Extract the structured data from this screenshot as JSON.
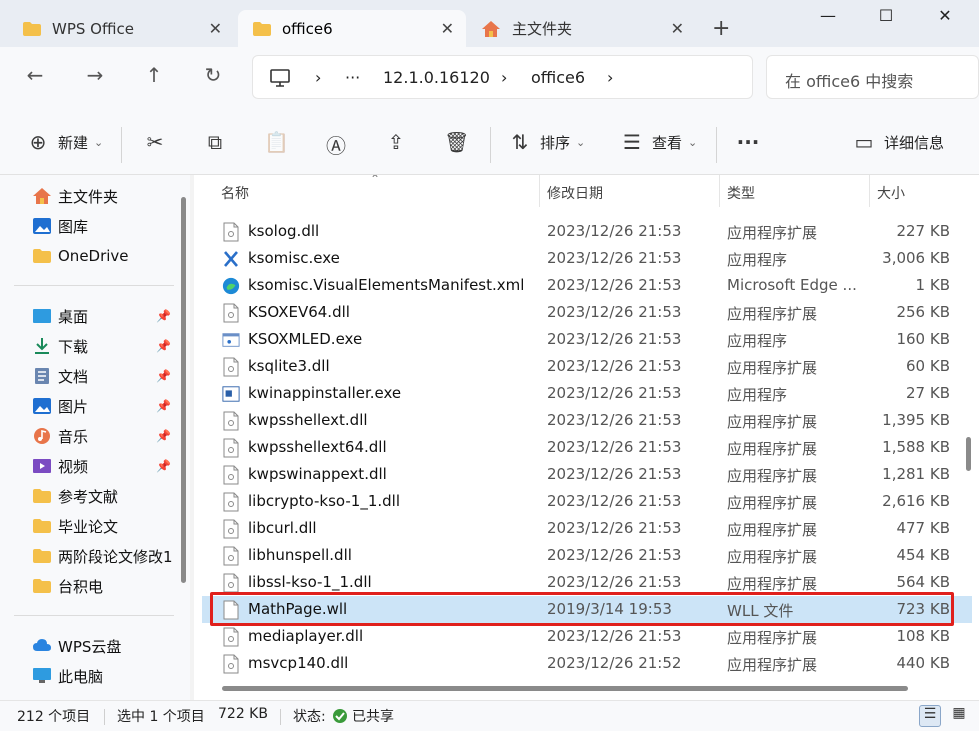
{
  "tabs": [
    {
      "label": "WPS Office",
      "icon": "folder-icon",
      "active": false
    },
    {
      "label": "office6",
      "icon": "folder-icon",
      "active": true
    },
    {
      "label": "主文件夹",
      "icon": "home-icon",
      "active": false
    }
  ],
  "address": {
    "crumbs": [
      "12.1.0.16120",
      "office6"
    ],
    "overflow": "···",
    "chevron": "›"
  },
  "search": {
    "placeholder": "在 office6 中搜索"
  },
  "toolbar": {
    "new_label": "新建",
    "sort_label": "排序",
    "view_label": "查看",
    "more_label": "···",
    "details_label": "详细信息"
  },
  "sidebar": {
    "quick": [
      {
        "label": "主文件夹",
        "icon": "home-icon"
      },
      {
        "label": "图库",
        "icon": "gallery-icon"
      },
      {
        "label": "OneDrive",
        "icon": "folder-icon"
      }
    ],
    "pinned": [
      {
        "label": "桌面",
        "icon": "desktop-icon",
        "pinned": true
      },
      {
        "label": "下载",
        "icon": "download-icon",
        "pinned": true
      },
      {
        "label": "文档",
        "icon": "document-icon",
        "pinned": true
      },
      {
        "label": "图片",
        "icon": "pictures-icon",
        "pinned": true
      },
      {
        "label": "音乐",
        "icon": "music-icon",
        "pinned": true
      },
      {
        "label": "视频",
        "icon": "video-icon",
        "pinned": true
      },
      {
        "label": "参考文献",
        "icon": "folder-icon",
        "pinned": false
      },
      {
        "label": "毕业论文",
        "icon": "folder-icon",
        "pinned": false
      },
      {
        "label": "两阶段论文修改1",
        "icon": "folder-icon",
        "pinned": false
      },
      {
        "label": "台积电",
        "icon": "folder-icon",
        "pinned": false
      }
    ],
    "drives": [
      {
        "label": "WPS云盘",
        "icon": "cloud-icon"
      },
      {
        "label": "此电脑",
        "icon": "computer-icon"
      }
    ]
  },
  "columns": {
    "name": "名称",
    "date": "修改日期",
    "type": "类型",
    "size": "大小"
  },
  "files": [
    {
      "name": "ksolog.dll",
      "date": "2023/12/26 21:53",
      "type": "应用程序扩展",
      "size": "227 KB",
      "icon": "dll-file-icon"
    },
    {
      "name": "ksomisc.exe",
      "date": "2023/12/26 21:53",
      "type": "应用程序",
      "size": "3,006 KB",
      "icon": "tools-icon"
    },
    {
      "name": "ksomisc.VisualElementsManifest.xml",
      "date": "2023/12/26 21:53",
      "type": "Microsoft Edge ...",
      "size": "1 KB",
      "icon": "edge-icon"
    },
    {
      "name": "KSOXEV64.dll",
      "date": "2023/12/26 21:53",
      "type": "应用程序扩展",
      "size": "256 KB",
      "icon": "dll-file-icon"
    },
    {
      "name": "KSOXMLED.exe",
      "date": "2023/12/26 21:53",
      "type": "应用程序",
      "size": "160 KB",
      "icon": "exe-window-icon"
    },
    {
      "name": "ksqlite3.dll",
      "date": "2023/12/26 21:53",
      "type": "应用程序扩展",
      "size": "60 KB",
      "icon": "dll-file-icon"
    },
    {
      "name": "kwinappinstaller.exe",
      "date": "2023/12/26 21:53",
      "type": "应用程序",
      "size": "27 KB",
      "icon": "exe-installer-icon"
    },
    {
      "name": "kwpsshellext.dll",
      "date": "2023/12/26 21:53",
      "type": "应用程序扩展",
      "size": "1,395 KB",
      "icon": "dll-file-icon"
    },
    {
      "name": "kwpsshellext64.dll",
      "date": "2023/12/26 21:53",
      "type": "应用程序扩展",
      "size": "1,588 KB",
      "icon": "dll-file-icon"
    },
    {
      "name": "kwpswinappext.dll",
      "date": "2023/12/26 21:53",
      "type": "应用程序扩展",
      "size": "1,281 KB",
      "icon": "dll-file-icon"
    },
    {
      "name": "libcrypto-kso-1_1.dll",
      "date": "2023/12/26 21:53",
      "type": "应用程序扩展",
      "size": "2,616 KB",
      "icon": "dll-file-icon"
    },
    {
      "name": "libcurl.dll",
      "date": "2023/12/26 21:53",
      "type": "应用程序扩展",
      "size": "477 KB",
      "icon": "dll-file-icon"
    },
    {
      "name": "libhunspell.dll",
      "date": "2023/12/26 21:53",
      "type": "应用程序扩展",
      "size": "454 KB",
      "icon": "dll-file-icon"
    },
    {
      "name": "libssl-kso-1_1.dll",
      "date": "2023/12/26 21:53",
      "type": "应用程序扩展",
      "size": "564 KB",
      "icon": "dll-file-icon"
    },
    {
      "name": "MathPage.wll",
      "date": "2019/3/14 19:53",
      "type": "WLL 文件",
      "size": "723 KB",
      "icon": "blank-file-icon",
      "selected": true
    },
    {
      "name": "mediaplayer.dll",
      "date": "2023/12/26 21:53",
      "type": "应用程序扩展",
      "size": "108 KB",
      "icon": "dll-file-icon"
    },
    {
      "name": "msvcp140.dll",
      "date": "2023/12/26 21:52",
      "type": "应用程序扩展",
      "size": "440 KB",
      "icon": "dll-file-icon"
    }
  ],
  "status": {
    "count": "212 个项目",
    "selection": "选中 1 个项目",
    "selection_size": "722 KB",
    "share_label": "状态:",
    "share_value": "已共享"
  }
}
